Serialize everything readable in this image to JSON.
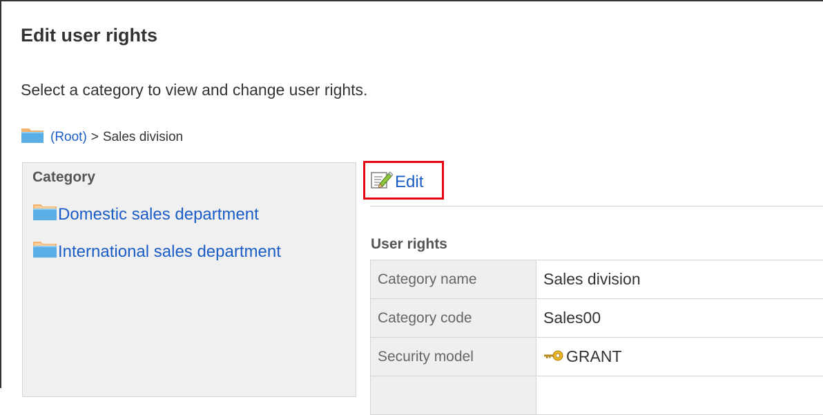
{
  "page": {
    "title": "Edit user rights",
    "description": "Select a category to view and change user rights."
  },
  "breadcrumb": {
    "root_label": "(Root)",
    "separator": ">",
    "current": "Sales division"
  },
  "category_panel": {
    "heading": "Category",
    "items": [
      {
        "label": "Domestic sales department"
      },
      {
        "label": "International sales department"
      }
    ]
  },
  "toolbar": {
    "edit_label": "Edit",
    "highlight_color": "#e60012"
  },
  "user_rights": {
    "heading": "User rights",
    "rows": [
      {
        "label": "Category name",
        "value": "Sales division"
      },
      {
        "label": "Category code",
        "value": "Sales00"
      },
      {
        "label": "Security model",
        "value": "GRANT",
        "icon": "key-icon"
      }
    ]
  },
  "colors": {
    "link": "#1a5cc8",
    "panel_background": "#f0f0f0",
    "header_cell_background": "#efefef"
  }
}
